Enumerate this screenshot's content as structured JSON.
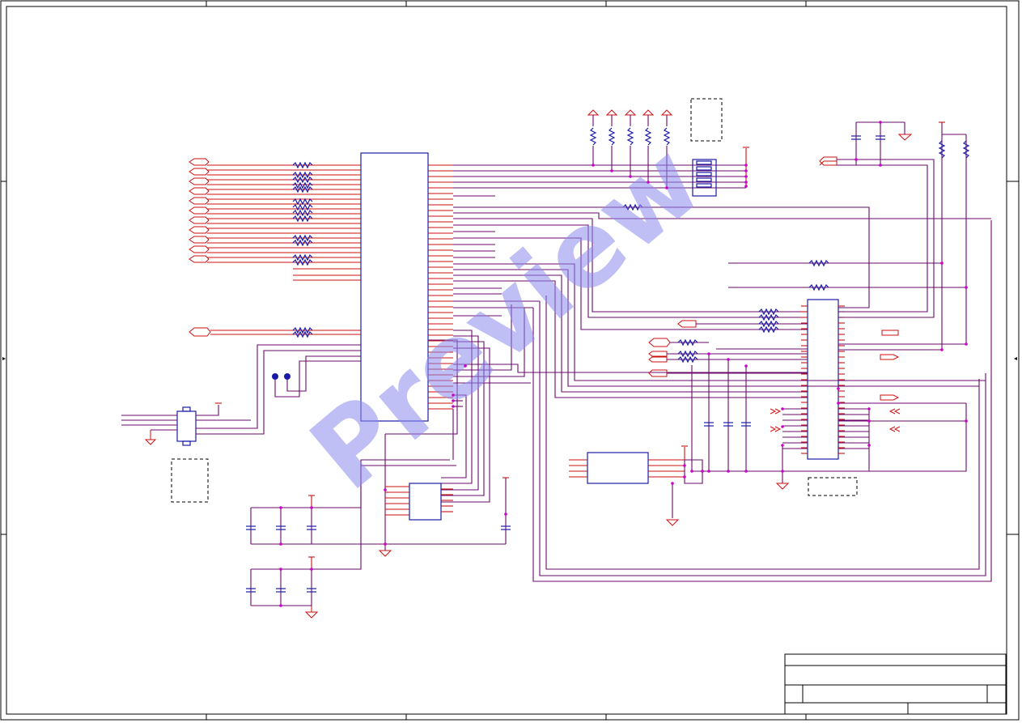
{
  "watermark": {
    "text": "Preview",
    "color": "#8c8cf0"
  },
  "colors": {
    "wire": "#6a0a6a",
    "pin": "#cc1111",
    "component": "#1a1aa6",
    "junction": "#cc00cc",
    "frame": "#000000"
  },
  "title_block": {}
}
